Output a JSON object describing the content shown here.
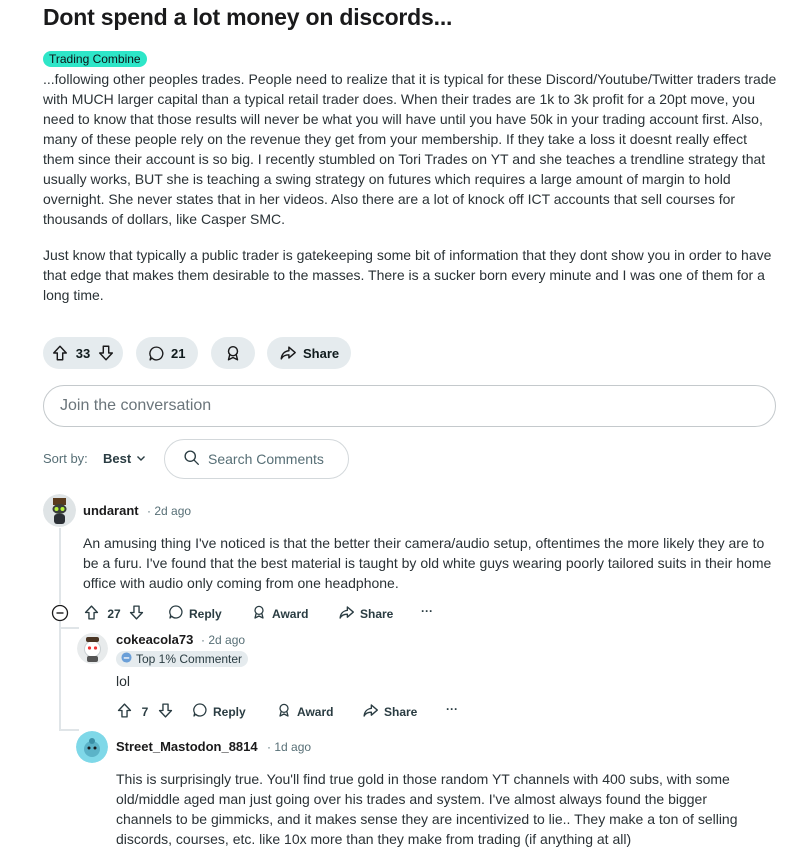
{
  "post": {
    "title": "Dont spend a lot money on discords...",
    "flair": "Trading Combine",
    "paragraphs": [
      "...following other peoples trades. People need to realize that it is typical for these Discord/Youtube/Twitter traders trade with MUCH larger capital than a typical retail trader does. When their trades are 1k to 3k profit for a 20pt move, you need to know that those results will never be what you will have until you have 50k in your trading account first. Also, many of these people rely on the revenue they get from your membership. If they take a loss it doesnt really effect them since their account is so big. I recently stumbled on Tori Trades on YT and she teaches a trendline strategy that usually works, BUT she is teaching a swing strategy on futures which requires a large amount of margin to hold overnight. She never states that in her videos. Also there are a lot of knock off ICT accounts that sell courses for thousands of dollars, like Casper SMC.",
      "Just know that typically a public trader is gatekeeping some bit of information that they dont show you in order to have that edge that makes them desirable to the masses. There is a sucker born every minute and I was one of them for a long time."
    ],
    "upvotes": "33",
    "comments": "21",
    "share_label": "Share"
  },
  "join": {
    "placeholder": "Join the conversation"
  },
  "sort": {
    "label": "Sort by:",
    "value": "Best"
  },
  "search": {
    "placeholder": "Search Comments"
  },
  "comments": [
    {
      "user": "undarant",
      "time": "2d ago",
      "text": "An amusing thing I've noticed is that the better their camera/audio setup, oftentimes the more likely they are to be a furu. I've found that the best material is taught by old white guys wearing poorly tailored suits in their home office with audio only coming from one headphone.",
      "votes": "27",
      "reply": "Reply",
      "award": "Award",
      "share": "Share",
      "more": "···"
    },
    {
      "user": "cokeacola73",
      "time": "2d ago",
      "badge": "Top 1% Commenter",
      "text": "lol",
      "votes": "7",
      "reply": "Reply",
      "award": "Award",
      "share": "Share",
      "more": "···"
    },
    {
      "user": "Street_Mastodon_8814",
      "time": "1d ago",
      "text": "This is surprisingly true. You'll find true gold in those random YT channels with 400 subs, with some old/middle aged man just going over his trades and system. I've almost always found the bigger channels to be gimmicks, and it makes sense they are incentivized to lie.. They make a ton of selling discords, courses, etc. like 10x more than they make from trading (if anything at all)"
    }
  ],
  "colors": {
    "flair_bg": "#2ee6c8",
    "pill_bg": "#e5ebee",
    "text": "#2a3236",
    "meta": "#576f76"
  }
}
